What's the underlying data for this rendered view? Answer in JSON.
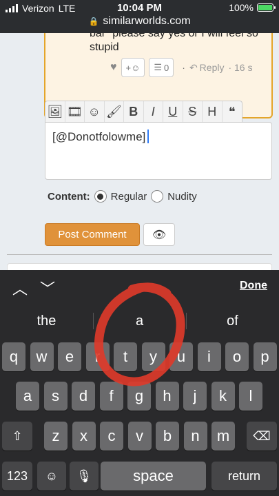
{
  "status": {
    "carrier": "Verizon",
    "network": "LTE",
    "time": "10:04 PM",
    "battery": "100%",
    "battery_fill": 1.0,
    "url": "similarworlds.com"
  },
  "comment": {
    "line1": "bar\" please say yes or I will feel so",
    "line2": "stupid",
    "reaction_label": "+☺",
    "list_count": "0",
    "reply_label": "Reply",
    "age": "· 16 s",
    "sep": "·"
  },
  "editor": {
    "toolbar": [
      "image-icon",
      "video-icon",
      "smiley-icon",
      "brush-icon",
      "bold-icon",
      "italic-icon",
      "underline-icon",
      "strikethrough-icon",
      "heading-icon",
      "quote-icon"
    ],
    "toolbar_glyphs": [
      "🖼",
      "🎞",
      "☺",
      "🖌",
      "B",
      "I",
      "U",
      "S",
      "H",
      "❝"
    ],
    "value": "[@Donotfolowme]"
  },
  "content_filter": {
    "label": "Content:",
    "options": [
      "Regular",
      "Nudity"
    ],
    "selected": "Regular"
  },
  "buttons": {
    "post": "Post Comment",
    "preview_icon": "eye-icon"
  },
  "keyboard": {
    "done": "Done",
    "suggestions": [
      "the",
      "a",
      "of"
    ],
    "row1": [
      "q",
      "w",
      "e",
      "r",
      "t",
      "y",
      "u",
      "i",
      "o",
      "p"
    ],
    "row2": [
      "a",
      "s",
      "d",
      "f",
      "g",
      "h",
      "j",
      "k",
      "l"
    ],
    "row3": [
      "z",
      "x",
      "c",
      "v",
      "b",
      "n",
      "m"
    ],
    "numbers": "123",
    "space": "space",
    "return": "return"
  },
  "colors": {
    "accent": "#e0923a",
    "card_border": "#e4a52a",
    "annotation": "#e03a2a"
  }
}
